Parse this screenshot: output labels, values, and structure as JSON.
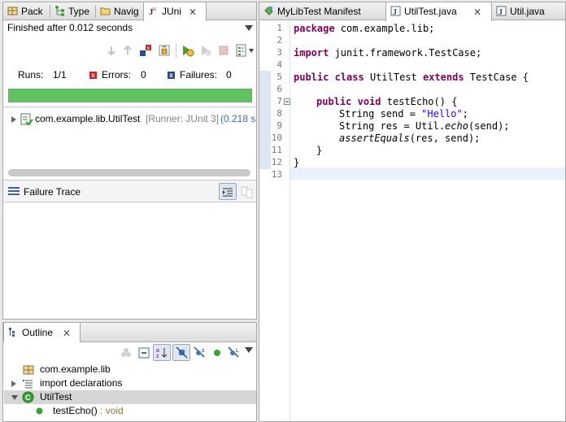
{
  "junit_view": {
    "tabs": [
      {
        "label": "Pack"
      },
      {
        "label": "Type"
      },
      {
        "label": "Navig"
      },
      {
        "label": "JUni"
      }
    ],
    "close_glyph": "⨯",
    "status": "Finished after 0.012 seconds",
    "runs_label": "Runs:",
    "runs_value": "1/1",
    "errors_label": "Errors:",
    "errors_value": "0",
    "failures_label": "Failures:",
    "failures_value": "0",
    "progress": 1.0,
    "progress_color": "#5fc35f",
    "test_row_class": "com.example.lib.UtilTest",
    "test_row_runner": "[Runner: JUnit 3]",
    "test_row_time": "(0.218 s",
    "failure_trace_label": "Failure Trace"
  },
  "outline_view": {
    "tab_label": "Outline",
    "items": [
      {
        "label": "com.example.lib",
        "detail": ""
      },
      {
        "label": "import declarations",
        "detail": ""
      },
      {
        "label": "UtilTest",
        "detail": ""
      },
      {
        "label": "testEcho()",
        "detail": " : void"
      }
    ]
  },
  "editor": {
    "tabs": [
      {
        "label": "MyLibTest Manifest"
      },
      {
        "label": "UtilTest.java"
      },
      {
        "label": "Util.java"
      }
    ],
    "line_numbers": [
      "1",
      "2",
      "3",
      "4",
      "5",
      "6",
      "7",
      "8",
      "9",
      "10",
      "11",
      "12",
      "13"
    ],
    "code": {
      "l1_kw": "package",
      "l1_rest": " com.example.lib;",
      "l3_kw": "import",
      "l3_rest": " junit.framework.TestCase;",
      "l5_kw1": "public",
      "l5_kw2": "class",
      "l5_mid": " UtilTest ",
      "l5_kw3": "extends",
      "l5_rest": " TestCase {",
      "l7_kw1": "public",
      "l7_kw2": "void",
      "l7_rest": " testEcho() {",
      "l8_a": "String send = ",
      "l8_str": "\"Hello\"",
      "l8_b": ";",
      "l9_a": "String res = Util.",
      "l9_it": "echo",
      "l9_b": "(send);",
      "l10_it": "assertEquals",
      "l10_b": "(res, send);",
      "l11": "}",
      "l12": "}"
    },
    "keyword_color": "#7f0055",
    "string_color": "#2a00ff"
  }
}
